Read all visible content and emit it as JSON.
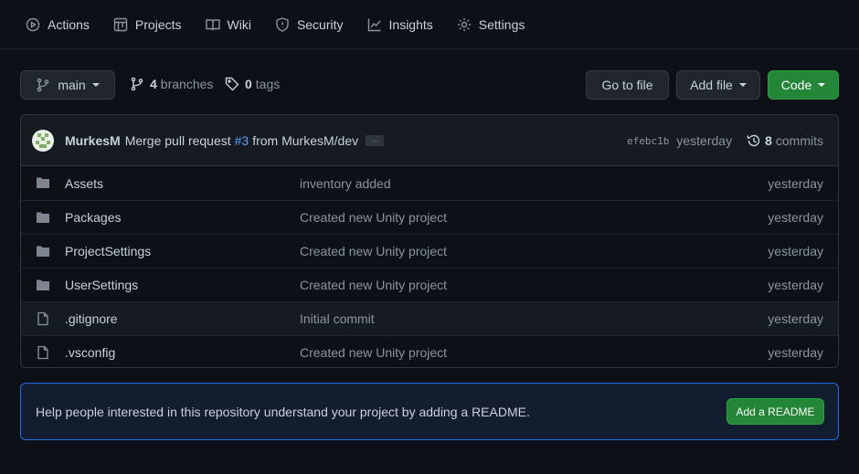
{
  "tabs": [
    {
      "label": "Actions",
      "icon": "actions-icon"
    },
    {
      "label": "Projects",
      "icon": "projects-icon"
    },
    {
      "label": "Wiki",
      "icon": "wiki-icon"
    },
    {
      "label": "Security",
      "icon": "shield-icon"
    },
    {
      "label": "Insights",
      "icon": "graph-icon"
    },
    {
      "label": "Settings",
      "icon": "gear-icon"
    }
  ],
  "toolbar": {
    "branch": "main",
    "branches_count": "4",
    "branches_label": "branches",
    "tags_count": "0",
    "tags_label": "tags",
    "goto_label": "Go to file",
    "add_label": "Add file",
    "code_label": "Code"
  },
  "commit": {
    "author": "MurkesM",
    "message": "Merge pull request",
    "pr": "#3",
    "from": "from MurkesM/dev",
    "ellipsis": "…",
    "sha": "efebc1b",
    "when": "yesterday",
    "commits_count": "8",
    "commits_label": "commits"
  },
  "files": [
    {
      "type": "folder",
      "name": "Assets",
      "message": "inventory added",
      "age": "yesterday"
    },
    {
      "type": "folder",
      "name": "Packages",
      "message": "Created new Unity project",
      "age": "yesterday"
    },
    {
      "type": "folder",
      "name": "ProjectSettings",
      "message": "Created new Unity project",
      "age": "yesterday"
    },
    {
      "type": "folder",
      "name": "UserSettings",
      "message": "Created new Unity project",
      "age": "yesterday"
    },
    {
      "type": "file",
      "name": ".gitignore",
      "message": "Initial commit",
      "age": "yesterday"
    },
    {
      "type": "file",
      "name": ".vsconfig",
      "message": "Created new Unity project",
      "age": "yesterday"
    }
  ],
  "readme": {
    "text": "Help people interested in this repository understand your project by adding a README.",
    "button": "Add a README"
  },
  "colors": {
    "background": "#0d1117",
    "accent_green": "#238636",
    "link_blue": "#58a6ff",
    "folder": "#7d8590"
  }
}
